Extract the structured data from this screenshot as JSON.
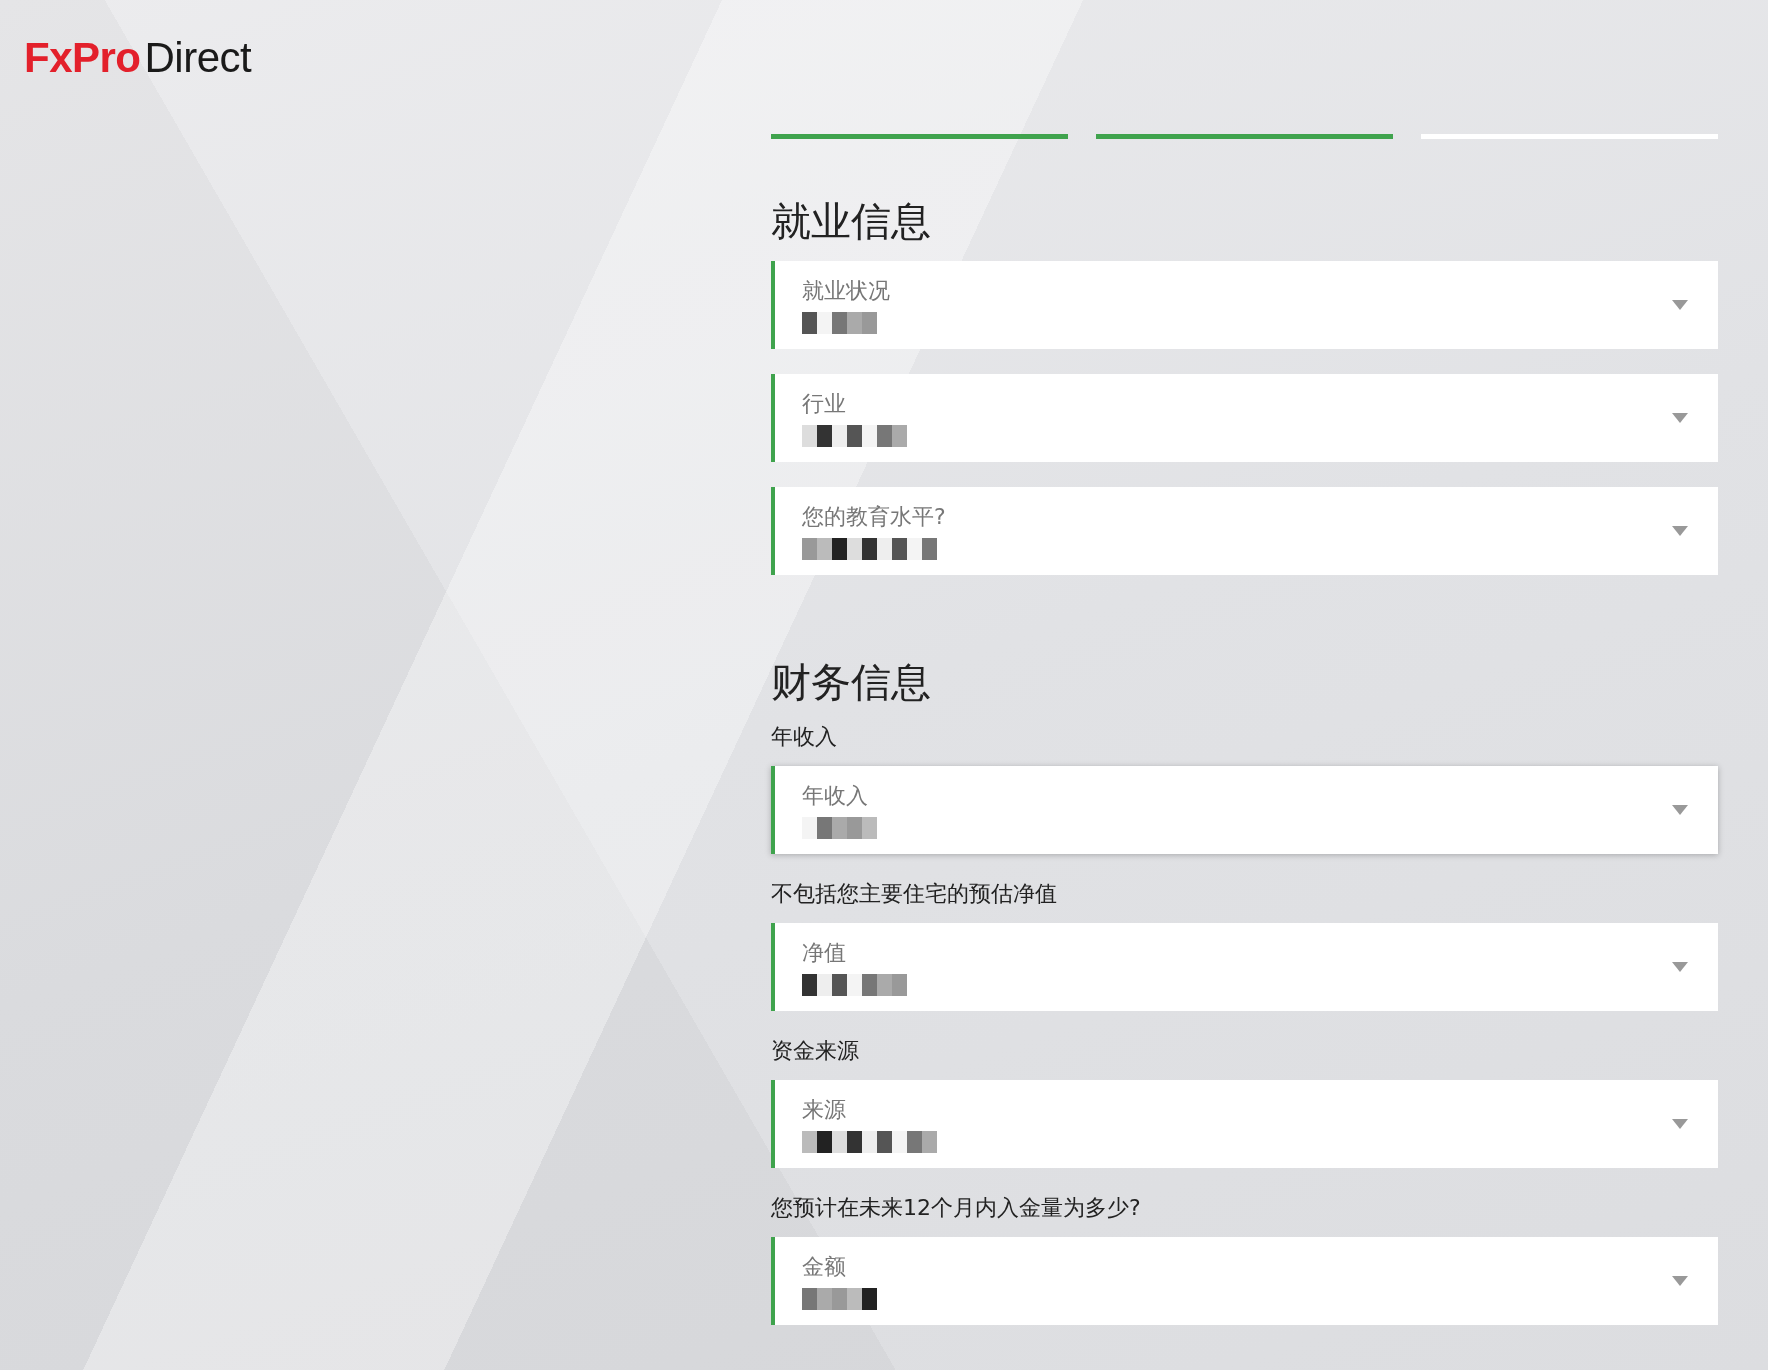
{
  "logo": {
    "brand": "FxPro",
    "product": "Direct"
  },
  "steps": [
    {
      "complete": true
    },
    {
      "complete": true
    },
    {
      "complete": false
    }
  ],
  "sections": [
    {
      "title": "就业信息",
      "fields": [
        {
          "label": "就业状况",
          "focused": false
        },
        {
          "label": "行业",
          "focused": false
        },
        {
          "label": "您的教育水平?",
          "focused": false
        }
      ]
    },
    {
      "title": "财务信息",
      "fields": [
        {
          "question": "年收入",
          "label": "年收入",
          "focused": true
        },
        {
          "question": "不包括您主要住宅的预估净值",
          "label": "净值",
          "focused": false
        },
        {
          "question": "资金来源",
          "label": "来源",
          "focused": false
        },
        {
          "question": "您预计在未来12个月内入金量为多少?",
          "label": "金额",
          "focused": false
        }
      ]
    }
  ]
}
